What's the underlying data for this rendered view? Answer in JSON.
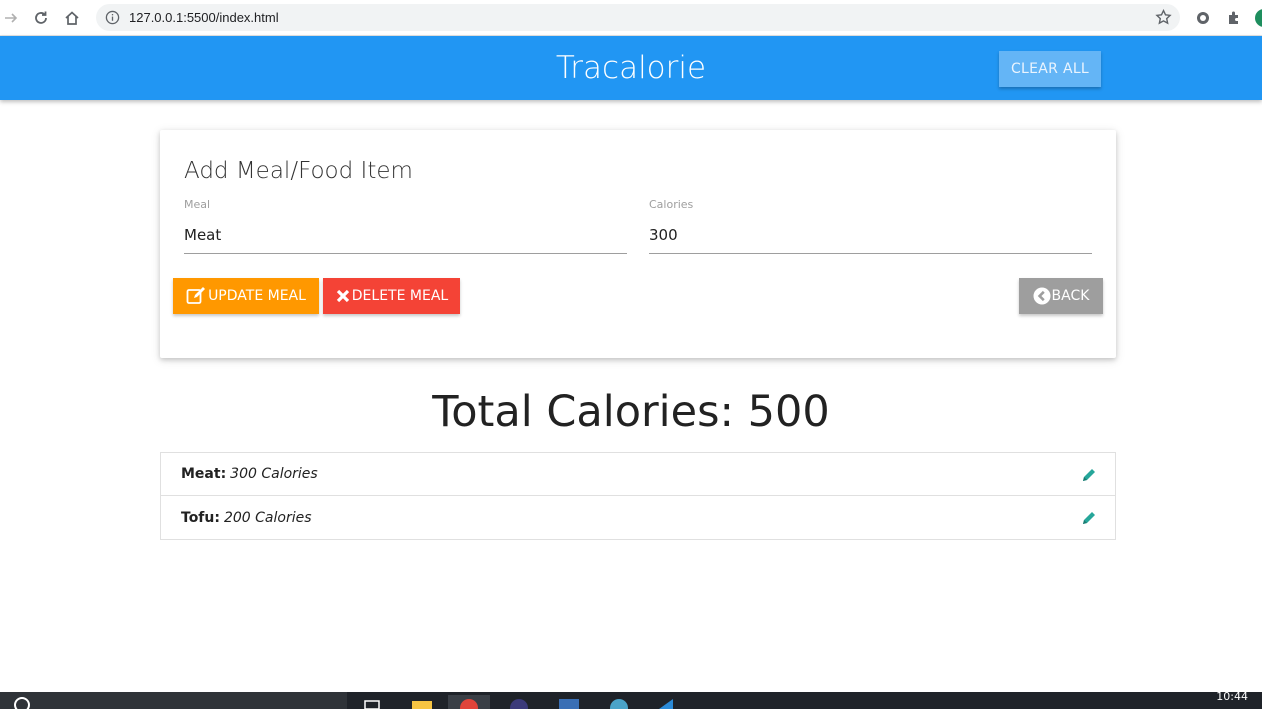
{
  "browser": {
    "url": "127.0.0.1:5500/index.html"
  },
  "header": {
    "brand": "Tracalorie",
    "clear_label": "CLEAR ALL"
  },
  "form": {
    "title": "Add Meal/Food Item",
    "meal_label": "Meal",
    "meal_value": "Meat",
    "calories_label": "Calories",
    "calories_value": "300",
    "update_label": "UPDATE MEAL",
    "delete_label": "DELETE MEAL",
    "back_label": "BACK"
  },
  "total": {
    "text": "Total Calories: 500"
  },
  "items": [
    {
      "name": "Meat:",
      "calories": "300 Calories"
    },
    {
      "name": "Tofu:",
      "calories": "200 Calories"
    }
  ],
  "taskbar": {
    "time": "10:44"
  },
  "colors": {
    "primary": "#2196f3",
    "update": "#ff9800",
    "delete": "#f44336",
    "back": "#9e9e9e",
    "edit_icon": "#26a69a"
  }
}
